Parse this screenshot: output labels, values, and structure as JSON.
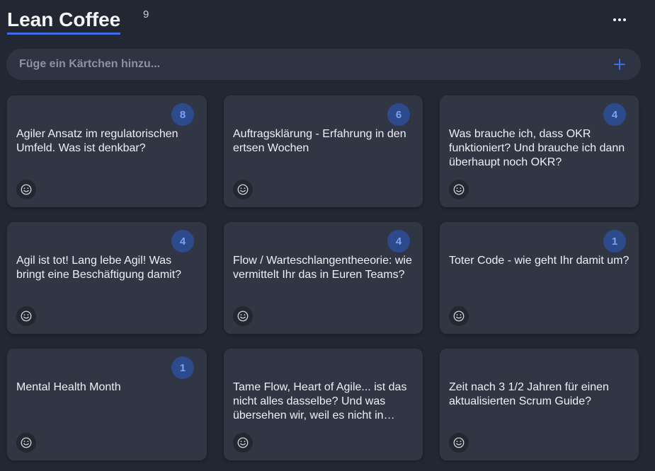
{
  "board": {
    "title": "Lean Coffee",
    "card_count": "9"
  },
  "add_card": {
    "placeholder": "Füge ein Kärtchen hinzu..."
  },
  "icons": {
    "menu": "more-horizontal-icon",
    "add": "plus-icon",
    "reaction": "smiley-icon"
  },
  "colors": {
    "accent": "#3b6fe8",
    "background": "#222733",
    "card": "#313645",
    "vote_badge": "#2d4a8c"
  },
  "cards": [
    {
      "votes": "8",
      "text": "Agiler Ansatz im regulatorischen Umfeld. Was ist denkbar?"
    },
    {
      "votes": "6",
      "text": "Auftragsklärung - Erfahrung in den ertsen Wochen"
    },
    {
      "votes": "4",
      "text": "Was brauche ich, dass OKR funktioniert? Und brauche ich dann überhaupt noch OKR?"
    },
    {
      "votes": "4",
      "text": "Agil ist tot! Lang lebe Agil! Was bringt eine Beschäftigung damit?"
    },
    {
      "votes": "4",
      "text": "Flow / Warteschlangentheeorie: wie vermittelt Ihr das in Euren Teams?"
    },
    {
      "votes": "1",
      "text": "Toter Code - wie geht Ihr damit um?"
    },
    {
      "votes": "1",
      "text": "Mental Health Month"
    },
    {
      "votes": "",
      "text": "Tame Flow, Heart of Agile... ist das nicht alles dasselbe? Und was übersehen wir, weil es nicht in einem Framework steht?"
    },
    {
      "votes": "",
      "text": "Zeit nach 3 1/2 Jahren für einen aktualisierten Scrum Guide?"
    }
  ]
}
